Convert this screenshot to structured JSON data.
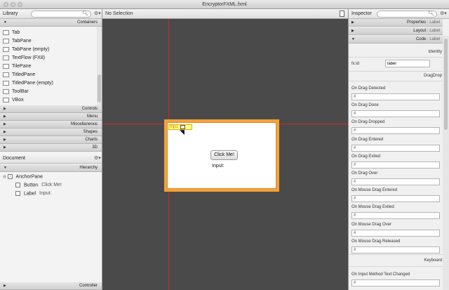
{
  "window": {
    "title": "EncryptorFXML.fxml"
  },
  "library": {
    "title": "Library",
    "containers_label": "Containers",
    "items": [
      {
        "label": "Tab",
        "icon": "tab-icon"
      },
      {
        "label": "TabPane",
        "icon": "tabpane-icon"
      },
      {
        "label": "TabPane  (empty)",
        "icon": "tabpane-icon"
      },
      {
        "label": "TextFlow  (FX8)",
        "icon": "textflow-icon"
      },
      {
        "label": "TilePane",
        "icon": "tilepane-icon"
      },
      {
        "label": "TitledPane",
        "icon": "titledpane-icon"
      },
      {
        "label": "TitledPane  (empty)",
        "icon": "titledpane-icon"
      },
      {
        "label": "ToolBar",
        "icon": "toolbar-icon"
      },
      {
        "label": "VBox",
        "icon": "vbox-icon"
      }
    ],
    "sections": [
      "Controls",
      "Menu",
      "Miscellaneous",
      "Shapes",
      "Charts",
      "3D"
    ]
  },
  "document": {
    "title": "Document",
    "hierarchy_label": "Hierarchy",
    "controller_label": "Controller",
    "tree": [
      {
        "type": "AnchorPane",
        "text": ""
      },
      {
        "type": "Button",
        "text": "Click Me!"
      },
      {
        "type": "Label",
        "text": "Input:"
      }
    ]
  },
  "canvas": {
    "selection_text": "No Selection",
    "button_text": "Click Me!",
    "label_text": "Input:",
    "selected_label_text": "Inpu"
  },
  "inspector": {
    "title": "Inspector",
    "sections": [
      {
        "name": "Properties",
        "suffix": "Label"
      },
      {
        "name": "Layout",
        "suffix": "Label"
      },
      {
        "name": "Code",
        "suffix": "Label"
      }
    ],
    "identity_label": "Identity",
    "fxid_label": "fx:id",
    "fxid_value": "label",
    "dragdrop_label": "DragDrop",
    "keyboard_label": "Keyboard",
    "hash_placeholder": "#",
    "events": [
      "On Drag Detected",
      "On Drag Done",
      "On Drag Dropped",
      "On Drag Entered",
      "On Drag Exited",
      "On Drag Over",
      "On Mouse Drag Entered",
      "On Mouse Drag Exited",
      "On Mouse Drag Over",
      "On Mouse Drag Released"
    ],
    "keyboard_events": [
      "On Input Method Text Changed"
    ]
  },
  "colors": {
    "guide": "#dd2222",
    "stage_border": "#f2a23a",
    "selection_fill": "#ffff88"
  }
}
